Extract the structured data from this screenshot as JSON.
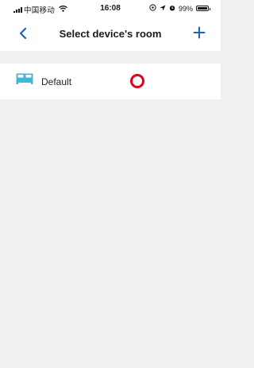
{
  "status_bar": {
    "carrier": "中国移动",
    "time": "16:08",
    "battery": "99%",
    "battery_level": 0.99,
    "icons": [
      "signal-icon",
      "wifi-icon",
      "location-icon",
      "alarm-icon",
      "battery-icon"
    ]
  },
  "nav": {
    "title": "Select device's room",
    "back_icon": "chevron-left-icon",
    "add_icon": "plus-icon"
  },
  "rooms": [
    {
      "label": "Default",
      "icon": "bed-icon",
      "selected": true
    }
  ],
  "colors": {
    "accent": "#1f5fbf",
    "room_icon": "#3fb7d9",
    "selection_marker": "#e60012",
    "background": "#f0f0f0"
  }
}
